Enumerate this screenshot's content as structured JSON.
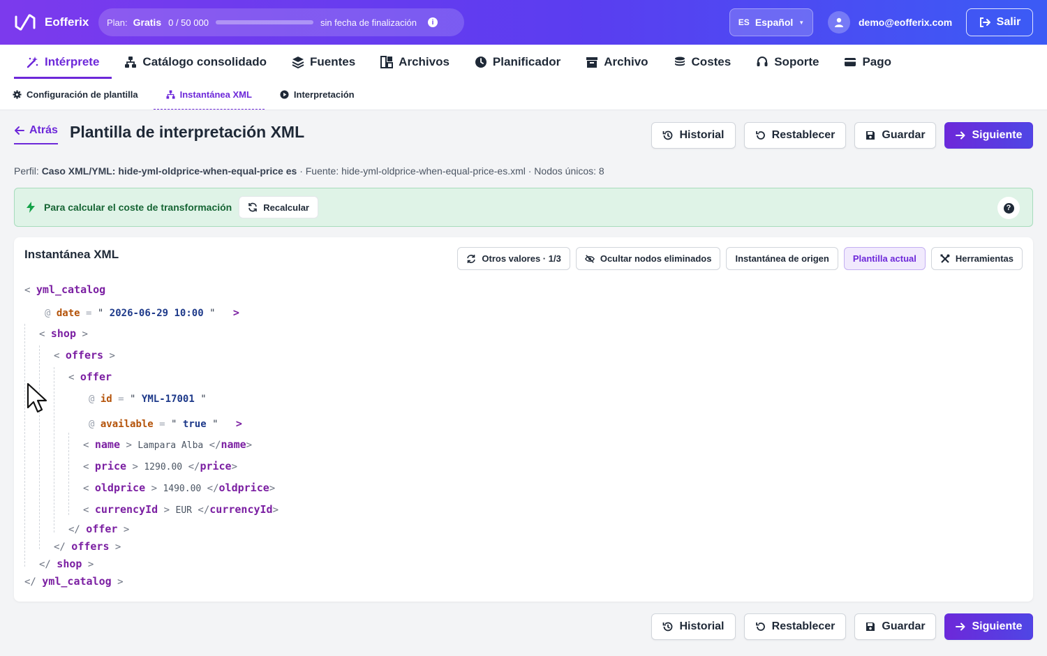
{
  "topbar": {
    "brand": "Eofferix",
    "plan_label": "Plan:",
    "plan_name": "Gratis",
    "usage": "0 / 50 000",
    "usage_fraction": 0,
    "plan_end": "sin fecha de finalización",
    "lang_code": "ES",
    "lang_name": "Español",
    "user_email": "demo@eofferix.com",
    "logout_label": "Salir"
  },
  "main_nav": [
    {
      "label": "Intérprete",
      "icon": "magic-wand-icon",
      "active": true
    },
    {
      "label": "Catálogo consolidado",
      "icon": "sitemap-icon"
    },
    {
      "label": "Fuentes",
      "icon": "layers-icon"
    },
    {
      "label": "Archivos",
      "icon": "grid-icon"
    },
    {
      "label": "Planificador",
      "icon": "clock-icon"
    },
    {
      "label": "Archivo",
      "icon": "archive-icon"
    },
    {
      "label": "Costes",
      "icon": "coins-icon"
    },
    {
      "label": "Soporte",
      "icon": "headset-icon"
    },
    {
      "label": "Pago",
      "icon": "credit-card-icon"
    }
  ],
  "sub_nav": [
    {
      "label": "Configuración de plantilla",
      "icon": "gear-icon"
    },
    {
      "label": "Instantánea XML",
      "icon": "sitemap-icon",
      "active": true
    },
    {
      "label": "Interpretación",
      "icon": "play-circle-icon"
    }
  ],
  "page": {
    "back_label": "Atrás",
    "title": "Plantilla de interpretación XML",
    "actions": {
      "history": "Historial",
      "reset": "Restablecer",
      "save": "Guardar",
      "next": "Siguiente"
    },
    "meta_profile_label": "Perfil:",
    "meta_profile": "Caso XML/YML: hide-yml-oldprice-when-equal-price es",
    "meta_rest": " · Fuente: hide-yml-oldprice-when-equal-price-es.xml · Nodos únicos: 8"
  },
  "notice": {
    "text": "Para calcular el coste de transformación",
    "recalc_label": "Recalcular",
    "help": "?"
  },
  "snapshot": {
    "title": "Instantánea XML",
    "tools": {
      "other_values": "Otros valores · 1/3",
      "hide_removed": "Ocultar nodos eliminados",
      "source_snapshot": "Instantánea de origen",
      "current_template": "Plantilla actual",
      "tools": "Herramientas"
    },
    "xml": {
      "root": "yml_catalog",
      "root_attr_name": "date",
      "root_attr_value": "2026-06-29 10:00",
      "shop": "shop",
      "offers": "offers",
      "offer": "offer",
      "offer_attrs": [
        {
          "name": "id",
          "value": "YML-17001"
        },
        {
          "name": "available",
          "value": "true"
        }
      ],
      "fields": [
        {
          "tag": "name",
          "value": "Lampara Alba"
        },
        {
          "tag": "price",
          "value": "1290.00"
        },
        {
          "tag": "oldprice",
          "value": "1490.00"
        },
        {
          "tag": "currencyId",
          "value": "EUR"
        }
      ]
    }
  },
  "colors": {
    "accent": "#6d28d9",
    "success_bg": "#dff3e7",
    "success_text": "#166534"
  }
}
